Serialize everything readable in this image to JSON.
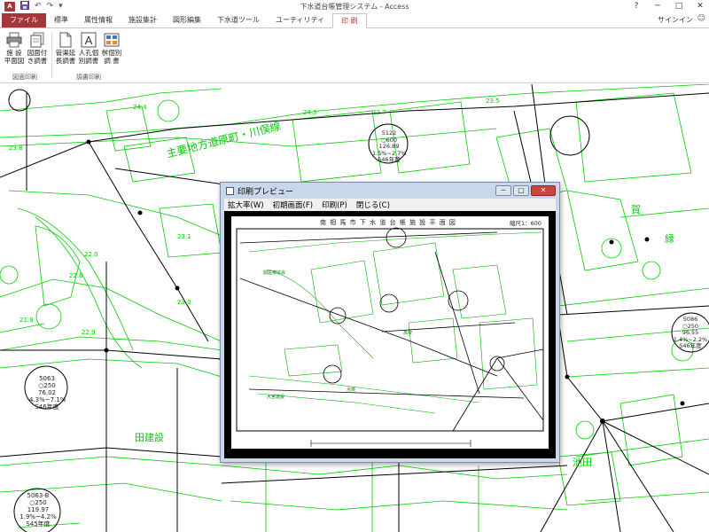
{
  "window": {
    "title": "下水道台帳管理システム - Access",
    "controls": [
      "?",
      "─",
      "□",
      "✕"
    ]
  },
  "quick_access": {
    "logo": "A",
    "icons": [
      "save-icon",
      "undo-icon",
      "redo-icon",
      "customize-icon"
    ]
  },
  "tabs": [
    {
      "label": "ファイル",
      "kind": "file"
    },
    {
      "label": "標準"
    },
    {
      "label": "属性情報"
    },
    {
      "label": "施設集計"
    },
    {
      "label": "図形編集"
    },
    {
      "label": "下水道ツール"
    },
    {
      "label": "ユーティリティ"
    },
    {
      "label": "印 刷",
      "active": true
    }
  ],
  "account": {
    "signin": "サインイン",
    "smiley": "☺"
  },
  "ribbon": {
    "groups": [
      {
        "label": "図面印刷",
        "buttons": [
          {
            "line1": "施 設",
            "line2": "平面図",
            "icon": "printer-icon"
          },
          {
            "line1": "図面付",
            "line2": "き調書",
            "icon": "documents-icon"
          }
        ]
      },
      {
        "label": "調書印刷",
        "buttons": [
          {
            "line1": "管渠延",
            "line2": "長調書",
            "icon": "document-icon"
          },
          {
            "line1": "人孔個",
            "line2": "別調書",
            "icon": "letter-a-icon"
          },
          {
            "line1": "桝個別",
            "line2": "調 書",
            "icon": "table-icon"
          }
        ]
      }
    ]
  },
  "map": {
    "colors": {
      "line": "#00cc00",
      "ink": "#000000"
    },
    "street_label": "主要地方道原町・川俣線",
    "labels": [
      "24.4",
      "24.5",
      "22.7",
      "23.5",
      "23.8",
      "23.1",
      "22.6",
      "22.0",
      "23.0",
      "21.9",
      "22.9",
      "田建設",
      "池田",
      "賀",
      "縁"
    ],
    "manholes": [
      {
        "no": "5122",
        "size": "○600",
        "depth": "126.89",
        "slope": "1.5%~2.7%",
        "year": "S46年度"
      },
      {
        "no": "5063",
        "size": "○250",
        "depth": "76.02",
        "slope": "4.3%~7.1%",
        "year": "S46年度"
      },
      {
        "no": "5063-B",
        "size": "○250",
        "depth": "119.97",
        "slope": "1.9%~4.2%",
        "year": "S45年度"
      },
      {
        "no": "5086",
        "size": "○250",
        "depth": "96.55",
        "slope": "1.4%~2.2%",
        "year": "S46年度"
      }
    ]
  },
  "preview": {
    "title": "印刷プレビュー",
    "menu": [
      "拡大率(W)",
      "初期画面(F)",
      "印刷(P)",
      "閉じる(C)"
    ],
    "page_title": "南 相 馬 市 下 水 道 台 帳  施 設 平 面 図",
    "page_scale": "縮尺1：600",
    "page_labels": [
      "関医療協会",
      "高校",
      "点検",
      "大宮建設"
    ]
  }
}
